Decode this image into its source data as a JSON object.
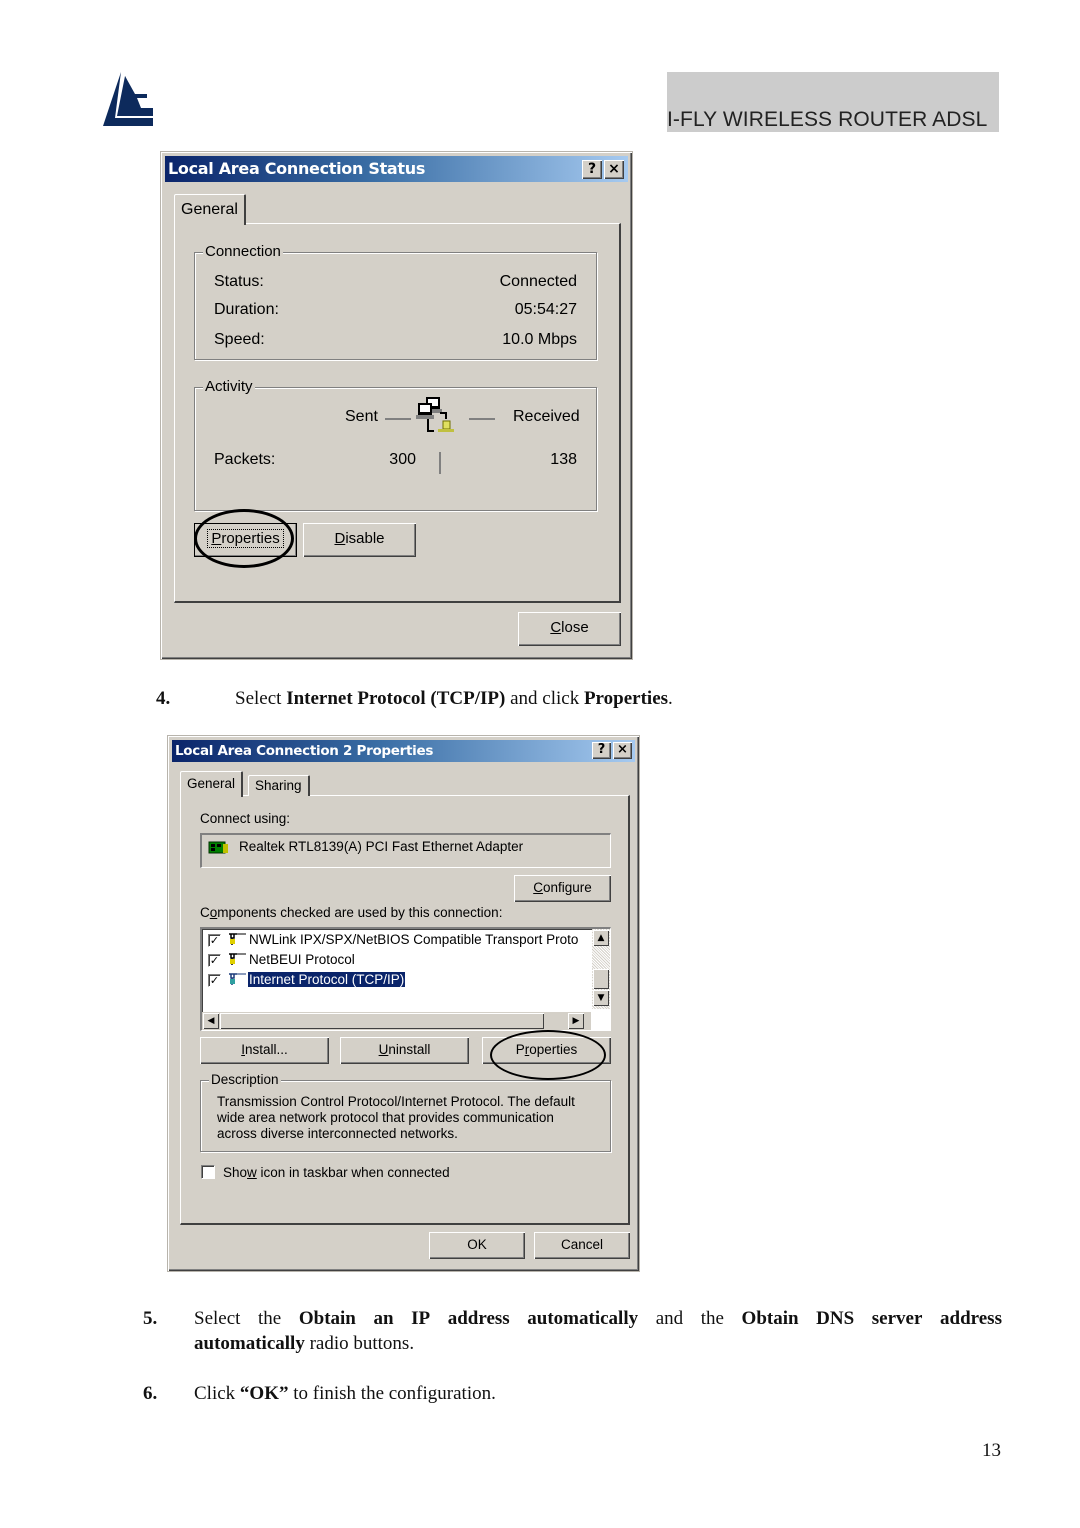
{
  "header": {
    "title": "I-FLY WIRELESS ROUTER ADSL",
    "logo_icon": "atlantis-triangle-logo-icon",
    "brand_color": "#0d2a5c"
  },
  "dialog1": {
    "title": "Local Area Connection Status",
    "help_label": "?",
    "close_x_label": "×",
    "tabs": [
      {
        "label": "General",
        "active": true
      }
    ],
    "connection": {
      "group_label": "Connection",
      "rows": [
        {
          "label": "Status:",
          "value": "Connected"
        },
        {
          "label": "Duration:",
          "value": "05:54:27"
        },
        {
          "label": "Speed:",
          "value": "10.0 Mbps"
        }
      ]
    },
    "activity": {
      "group_label": "Activity",
      "sent_label": "Sent",
      "received_label": "Received",
      "packets_label": "Packets:",
      "packets_sent": "300",
      "packets_received": "138",
      "icon": "network-computers-icon"
    },
    "buttons": {
      "properties": {
        "mnemonic": "P",
        "rest": "roperties",
        "highlighted": true
      },
      "disable": {
        "mnemonic": "D",
        "rest": "isable"
      },
      "close": {
        "mnemonic": "C",
        "rest": "lose"
      }
    }
  },
  "step4": {
    "number": "4.",
    "parts": [
      {
        "text": "Select ",
        "bold": false
      },
      {
        "text": "Internet Protocol (TCP/IP)",
        "bold": true
      },
      {
        "text": " and click ",
        "bold": false
      },
      {
        "text": "Properties",
        "bold": true
      },
      {
        "text": ".",
        "bold": false
      }
    ]
  },
  "dialog2": {
    "title": "Local Area Connection 2 Properties",
    "help_label": "?",
    "close_x_label": "×",
    "tabs": [
      {
        "label": "General",
        "active": true
      },
      {
        "label": "Sharing",
        "active": false
      }
    ],
    "connect_using_label": "Connect using:",
    "adapter": "Realtek RTL8139(A) PCI Fast Ethernet Adapter",
    "adapter_icon": "network-adapter-icon",
    "configure": {
      "mnemonic": "C",
      "rest": "onfigure"
    },
    "components_label": {
      "pre": "C",
      "mnemonic": "o",
      "rest": "mponents checked are used by this connection:"
    },
    "components": [
      {
        "label": "NWLink IPX/SPX/NetBIOS Compatible Transport Proto",
        "checked": true,
        "selected": false
      },
      {
        "label": "NetBEUI Protocol",
        "checked": true,
        "selected": false
      },
      {
        "label": "Internet Protocol (TCP/IP)",
        "checked": true,
        "selected": true
      }
    ],
    "buttons": {
      "install": {
        "mnemonic": "I",
        "rest": "nstall..."
      },
      "uninstall": {
        "mnemonic": "U",
        "rest": "ninstall"
      },
      "properties": {
        "pre": "P",
        "mnemonic": "r",
        "rest": "operties",
        "highlighted": true
      },
      "ok": "OK",
      "cancel": "Cancel"
    },
    "description": {
      "group_label": "Description",
      "lines": [
        "Transmission Control Protocol/Internet Protocol. The default",
        "wide area network protocol that provides communication",
        "across diverse interconnected networks."
      ]
    },
    "show_icon": {
      "pre": "Sho",
      "mnemonic": "w",
      "rest": " icon in taskbar when connected",
      "checked": false
    },
    "selection_color": "#0a246a"
  },
  "step5": {
    "number": "5.",
    "line1": [
      {
        "text": "Select the ",
        "bold": false
      },
      {
        "text": "Obtain an IP address automatically",
        "bold": true
      },
      {
        "text": " and the ",
        "bold": false
      },
      {
        "text": "Obtain DNS server address",
        "bold": true
      }
    ],
    "line2": [
      {
        "text": "automatically",
        "bold": true
      },
      {
        "text": " radio buttons.",
        "bold": false
      }
    ]
  },
  "step6": {
    "number": "6.",
    "parts": [
      {
        "text": "Click ",
        "bold": false
      },
      {
        "text": "“OK”",
        "bold": true
      },
      {
        "text": " to finish the configuration.",
        "bold": false
      }
    ]
  },
  "page_number": "13"
}
